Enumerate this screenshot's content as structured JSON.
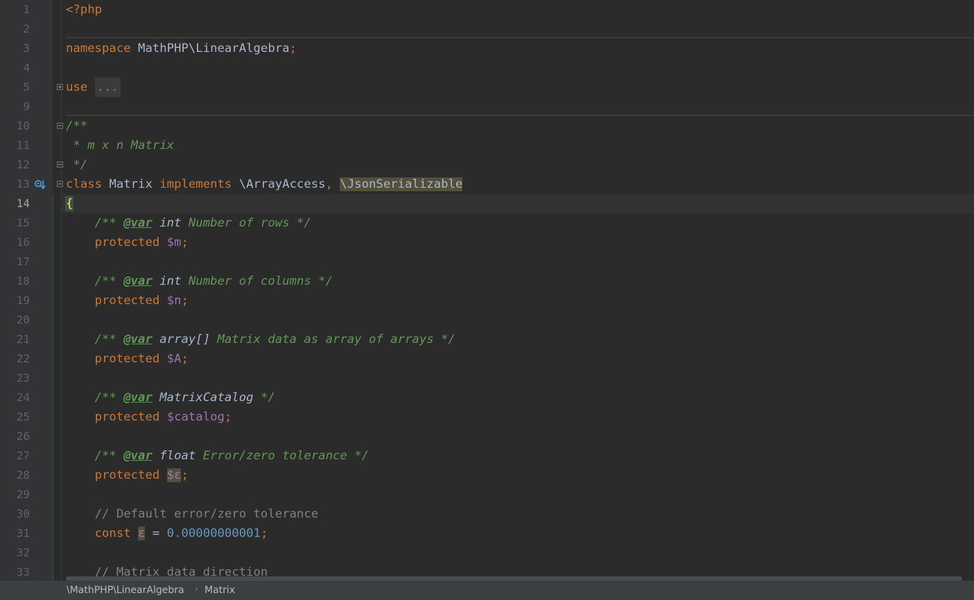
{
  "editor": {
    "current_line": 14,
    "lines": [
      {
        "n": "1",
        "tokens": [
          {
            "t": "<?php",
            "c": "kw"
          }
        ]
      },
      {
        "n": "2",
        "tokens": []
      },
      {
        "n": "3",
        "tokens": [
          {
            "t": "namespace ",
            "c": "kw"
          },
          {
            "t": "MathPHP\\LinearAlgebra",
            "c": "txt"
          },
          {
            "t": ";",
            "c": "kw"
          }
        ]
      },
      {
        "n": "4",
        "tokens": []
      },
      {
        "n": "5",
        "tokens": [
          {
            "t": "use ",
            "c": "kw"
          },
          {
            "t": "...",
            "c": "fold"
          }
        ]
      },
      {
        "n": "9",
        "tokens": []
      },
      {
        "n": "10",
        "tokens": [
          {
            "t": "/**",
            "c": "doc"
          }
        ]
      },
      {
        "n": "11",
        "tokens": [
          {
            "t": " * m x n Matrix",
            "c": "doc"
          }
        ]
      },
      {
        "n": "12",
        "tokens": [
          {
            "t": " */",
            "c": "doc"
          }
        ]
      },
      {
        "n": "13",
        "tokens": [
          {
            "t": "class ",
            "c": "kw"
          },
          {
            "t": "Matrix ",
            "c": "txt"
          },
          {
            "t": "implements ",
            "c": "kw"
          },
          {
            "t": "\\ArrayAccess",
            "c": "txt"
          },
          {
            "t": ", ",
            "c": "kw"
          },
          {
            "t": "\\JsonSerializable",
            "c": "txt hl"
          }
        ]
      },
      {
        "n": "14",
        "tokens": [
          {
            "t": "{",
            "c": "brace"
          }
        ]
      },
      {
        "n": "15",
        "tokens": [
          {
            "t": "    /** ",
            "c": "doc"
          },
          {
            "t": "@var",
            "c": "doctag"
          },
          {
            "t": " int ",
            "c": "doctype"
          },
          {
            "t": "Number of rows */",
            "c": "doc"
          }
        ]
      },
      {
        "n": "16",
        "tokens": [
          {
            "t": "    protected ",
            "c": "kw"
          },
          {
            "t": "$m",
            "c": "var"
          },
          {
            "t": ";",
            "c": "kw"
          }
        ]
      },
      {
        "n": "17",
        "tokens": []
      },
      {
        "n": "18",
        "tokens": [
          {
            "t": "    /** ",
            "c": "doc"
          },
          {
            "t": "@var",
            "c": "doctag"
          },
          {
            "t": " int ",
            "c": "doctype"
          },
          {
            "t": "Number of columns */",
            "c": "doc"
          }
        ]
      },
      {
        "n": "19",
        "tokens": [
          {
            "t": "    protected ",
            "c": "kw"
          },
          {
            "t": "$n",
            "c": "var"
          },
          {
            "t": ";",
            "c": "kw"
          }
        ]
      },
      {
        "n": "20",
        "tokens": []
      },
      {
        "n": "21",
        "tokens": [
          {
            "t": "    /** ",
            "c": "doc"
          },
          {
            "t": "@var",
            "c": "doctag"
          },
          {
            "t": " array[] ",
            "c": "doctype"
          },
          {
            "t": "Matrix data as array of arrays */",
            "c": "doc"
          }
        ]
      },
      {
        "n": "22",
        "tokens": [
          {
            "t": "    protected ",
            "c": "kw"
          },
          {
            "t": "$A",
            "c": "var"
          },
          {
            "t": ";",
            "c": "kw"
          }
        ]
      },
      {
        "n": "23",
        "tokens": []
      },
      {
        "n": "24",
        "tokens": [
          {
            "t": "    /** ",
            "c": "doc"
          },
          {
            "t": "@var",
            "c": "doctag"
          },
          {
            "t": " MatrixCatalog ",
            "c": "doctype"
          },
          {
            "t": "*/",
            "c": "doc"
          }
        ]
      },
      {
        "n": "25",
        "tokens": [
          {
            "t": "    protected ",
            "c": "kw"
          },
          {
            "t": "$catalog",
            "c": "var"
          },
          {
            "t": ";",
            "c": "kw"
          }
        ]
      },
      {
        "n": "26",
        "tokens": []
      },
      {
        "n": "27",
        "tokens": [
          {
            "t": "    /** ",
            "c": "doc"
          },
          {
            "t": "@var",
            "c": "doctag"
          },
          {
            "t": " float ",
            "c": "doctype"
          },
          {
            "t": "Error/zero tolerance */",
            "c": "doc"
          }
        ]
      },
      {
        "n": "28",
        "tokens": [
          {
            "t": "    protected ",
            "c": "kw"
          },
          {
            "t": "$ε",
            "c": "var hl"
          },
          {
            "t": ";",
            "c": "kw"
          }
        ]
      },
      {
        "n": "29",
        "tokens": []
      },
      {
        "n": "30",
        "tokens": [
          {
            "t": "    // Default error/zero tolerance",
            "c": "cmt"
          }
        ]
      },
      {
        "n": "31",
        "tokens": [
          {
            "t": "    const ",
            "c": "kw"
          },
          {
            "t": "ε",
            "c": "var hl"
          },
          {
            "t": " = ",
            "c": "txt"
          },
          {
            "t": "0.00000000001",
            "c": "num"
          },
          {
            "t": ";",
            "c": "kw"
          }
        ]
      },
      {
        "n": "32",
        "tokens": []
      },
      {
        "n": "33",
        "tokens": [
          {
            "t": "    // Matrix data direction",
            "c": "cmt"
          }
        ]
      }
    ]
  },
  "statusbar": {
    "breadcrumbs": [
      "\\MathPHP\\LinearAlgebra",
      "Matrix"
    ]
  },
  "colors": {
    "background": "#2b2b2b",
    "keyword": "#cc7832",
    "variable": "#9876aa",
    "doc_comment": "#629755",
    "number": "#6897bb"
  }
}
